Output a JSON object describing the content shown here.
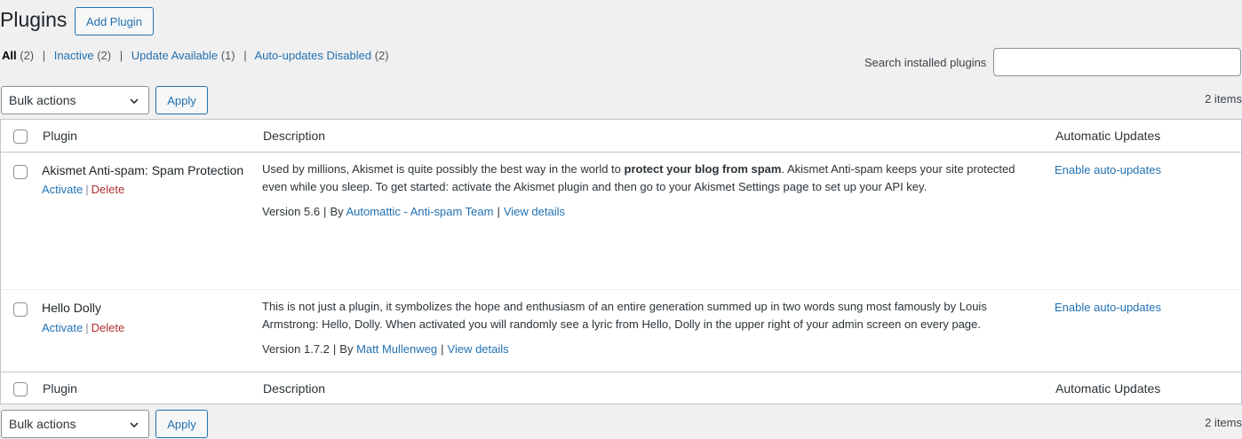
{
  "page": {
    "title": "Plugins",
    "add_button": "Add Plugin"
  },
  "filters": [
    {
      "label": "All",
      "count": "(2)"
    },
    {
      "label": "Inactive",
      "count": "(2)"
    },
    {
      "label": "Update Available",
      "count": "(1)"
    },
    {
      "label": "Auto-updates Disabled",
      "count": "(2)"
    }
  ],
  "search": {
    "label": "Search installed plugins",
    "value": ""
  },
  "bulk": {
    "select_value": "Bulk actions",
    "apply_label": "Apply",
    "items_count": "2 items"
  },
  "columns": {
    "plugin": "Plugin",
    "description": "Description",
    "auto_updates": "Automatic Updates"
  },
  "plugins": [
    {
      "name": "Akismet Anti-spam: Spam Protection",
      "activate": "Activate",
      "delete": "Delete",
      "desc_before": "Used by millions, Akismet is quite possibly the best way in the world to ",
      "desc_bold": "protect your blog from spam",
      "desc_after": ". Akismet Anti-spam keeps your site protected even while you sleep. To get started: activate the Akismet plugin and then go to your Akismet Settings page to set up your API key.",
      "version": "Version 5.6",
      "by": "By",
      "author": "Automattic - Anti-spam Team",
      "details": "View details",
      "auto_update": "Enable auto-updates"
    },
    {
      "name": "Hello Dolly",
      "activate": "Activate",
      "delete": "Delete",
      "desc": "This is not just a plugin, it symbolizes the hope and enthusiasm of an entire generation summed up in two words sung most famously by Louis Armstrong: Hello, Dolly. When activated you will randomly see a lyric from Hello, Dolly in the upper right of your admin screen on every page.",
      "version": "Version 1.7.2",
      "by": "By",
      "author": "Matt Mullenweg",
      "details": "View details",
      "auto_update": "Enable auto-updates"
    }
  ],
  "separators": {
    "pipe": "|"
  },
  "colors": {
    "link": "#2271b1",
    "delete": "#b32d2e",
    "background": "#f0f0f1",
    "border": "#c3c4c7"
  },
  "icons": {
    "select_arrow": "chevron-down-icon"
  }
}
